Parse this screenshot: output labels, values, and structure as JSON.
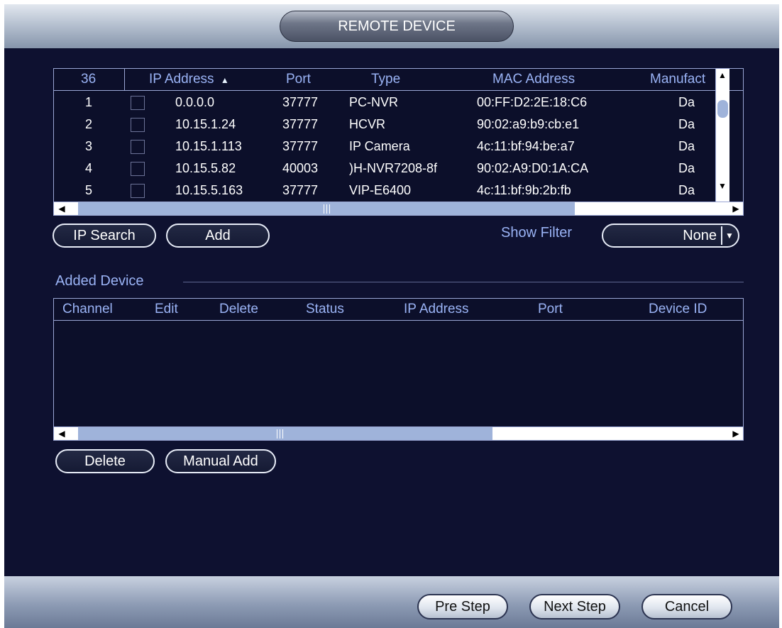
{
  "window": {
    "title": "REMOTE DEVICE"
  },
  "search_table": {
    "columns": {
      "count": "36",
      "ip": "IP Address",
      "sort_icon": "▲",
      "port": "Port",
      "type": "Type",
      "mac": "MAC Address",
      "manufacturer": "Manufact"
    },
    "rows": [
      {
        "index": "1",
        "ip": "0.0.0.0",
        "port": "37777",
        "type": "PC-NVR",
        "mac": "00:FF:D2:2E:18:C6",
        "manufacturer": "Da"
      },
      {
        "index": "2",
        "ip": "10.15.1.24",
        "port": "37777",
        "type": "HCVR",
        "mac": "90:02:a9:b9:cb:e1",
        "manufacturer": "Da"
      },
      {
        "index": "3",
        "ip": "10.15.1.113",
        "port": "37777",
        "type": "IP Camera",
        "mac": "4c:11:bf:94:be:a7",
        "manufacturer": "Da"
      },
      {
        "index": "4",
        "ip": "10.15.5.82",
        "port": "40003",
        "type": ")H-NVR7208-8f",
        "mac": "90:02:A9:D0:1A:CA",
        "manufacturer": "Da"
      },
      {
        "index": "5",
        "ip": "10.15.5.163",
        "port": "37777",
        "type": "VIP-E6400",
        "mac": "4c:11:bf:9b:2b:fb",
        "manufacturer": "Da"
      }
    ]
  },
  "actions": {
    "ip_search": "IP Search",
    "add": "Add",
    "show_filter_label": "Show Filter",
    "filter_value": "None"
  },
  "added_device": {
    "section_title": "Added Device",
    "columns": {
      "channel": "Channel",
      "edit": "Edit",
      "delete": "Delete",
      "status": "Status",
      "ip": "IP Address",
      "port": "Port",
      "device_id": "Device ID"
    }
  },
  "added_actions": {
    "delete": "Delete",
    "manual_add": "Manual Add"
  },
  "footer": {
    "pre_step": "Pre Step",
    "next_step": "Next Step",
    "cancel": "Cancel"
  },
  "colors": {
    "background": "#0e1130",
    "header_text": "#9ab3f5",
    "title_gradient_top": "#e2e7ef",
    "scroll_thumb": "#9fb3da"
  },
  "icons": {
    "sort": "sort-ascending-icon",
    "dropdown": "chevron-down-icon",
    "scroll_left": "arrow-left-icon",
    "scroll_right": "arrow-right-icon",
    "scroll_up": "arrow-up-icon",
    "scroll_down": "arrow-down-icon"
  }
}
